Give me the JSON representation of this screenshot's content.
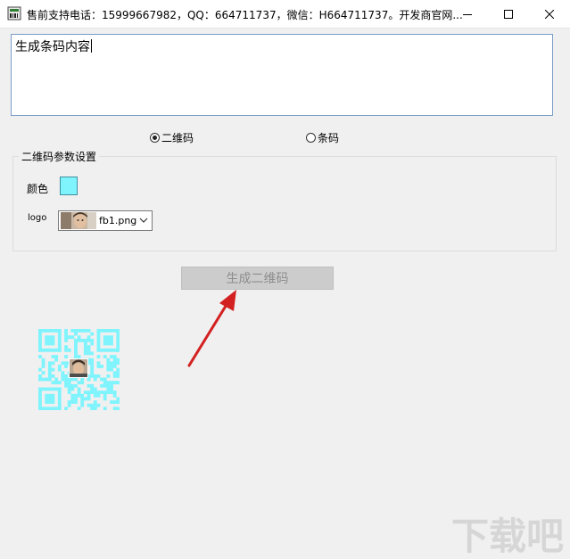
{
  "window": {
    "title": "售前支持电话：15999667982，QQ：664711737，微信：H664711737。开发商官网...",
    "minimize_icon": "minimize-icon",
    "maximize_icon": "maximize-icon",
    "close_icon": "close-icon"
  },
  "input": {
    "value": "生成条码内容"
  },
  "mode": {
    "options": [
      {
        "label": "二维码",
        "checked": true
      },
      {
        "label": "条码",
        "checked": false
      }
    ]
  },
  "qr_settings": {
    "title": "二维码参数设置",
    "color_label": "颜色",
    "color_value": "#7ff4fd",
    "logo_label": "logo",
    "logo_file": "fb1.png"
  },
  "generate_button": {
    "label": "生成二维码"
  },
  "colors": {
    "qr_color": "#7ff4fd",
    "arrow_color": "#d32020"
  },
  "watermark": {
    "text": "下载吧"
  }
}
